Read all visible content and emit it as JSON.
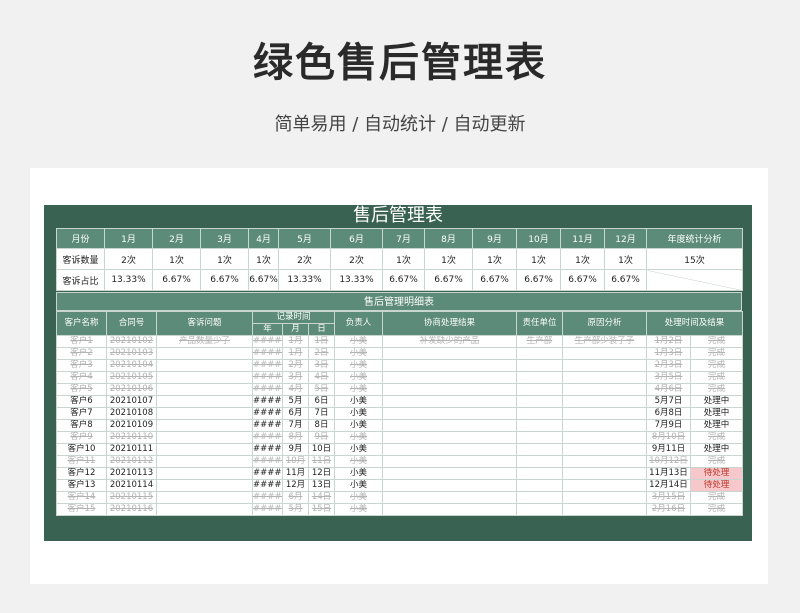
{
  "page": {
    "title": "绿色售后管理表",
    "subtitle": "简单易用 / 自动统计 / 自动更新"
  },
  "sheet": {
    "title": "售后管理表",
    "stats": {
      "header": [
        "月份",
        "1月",
        "2月",
        "3月",
        "4月",
        "5月",
        "6月",
        "7月",
        "8月",
        "9月",
        "10月",
        "11月",
        "12月",
        "年度统计分析"
      ],
      "count_label": "客诉数量",
      "counts": [
        "2次",
        "1次",
        "1次",
        "1次",
        "2次",
        "2次",
        "1次",
        "1次",
        "1次",
        "1次",
        "1次",
        "1次",
        "15次"
      ],
      "ratio_label": "客诉占比",
      "ratios": [
        "13.33%",
        "6.67%",
        "6.67%",
        "6.67%",
        "13.33%",
        "13.33%",
        "6.67%",
        "6.67%",
        "6.67%",
        "6.67%",
        "6.67%",
        "6.67%"
      ]
    },
    "detail_title": "售后管理明细表",
    "columns": {
      "customer": "客户名称",
      "contract": "合同号",
      "issue": "客诉问题",
      "record_time": "记录时间",
      "year": "年",
      "month": "月",
      "day": "日",
      "owner": "负责人",
      "negotiation": "协商处理结果",
      "responsible_unit": "责任单位",
      "cause": "原因分析",
      "result_time": "处理时间及结果"
    },
    "rows": [
      {
        "customer": "客户1",
        "contract": "20210102",
        "issue": "产品数量少了",
        "year": "#####",
        "month": "1月",
        "day": "1日",
        "owner": "小美",
        "negotiation": "补发缺少的产品",
        "unit": "生产部",
        "cause": "生产部少装了子",
        "date": "1月2日",
        "status": "完成",
        "state": "done"
      },
      {
        "customer": "客户2",
        "contract": "20210103",
        "issue": "",
        "year": "#####",
        "month": "1月",
        "day": "2日",
        "owner": "小美",
        "negotiation": "",
        "unit": "",
        "cause": "",
        "date": "1月3日",
        "status": "完成",
        "state": "done"
      },
      {
        "customer": "客户3",
        "contract": "20210104",
        "issue": "",
        "year": "#####",
        "month": "2月",
        "day": "3日",
        "owner": "小美",
        "negotiation": "",
        "unit": "",
        "cause": "",
        "date": "2月3日",
        "status": "完成",
        "state": "done"
      },
      {
        "customer": "客户4",
        "contract": "20210105",
        "issue": "",
        "year": "#####",
        "month": "3月",
        "day": "4日",
        "owner": "小美",
        "negotiation": "",
        "unit": "",
        "cause": "",
        "date": "3月5日",
        "status": "完成",
        "state": "done"
      },
      {
        "customer": "客户5",
        "contract": "20210106",
        "issue": "",
        "year": "#####",
        "month": "4月",
        "day": "5日",
        "owner": "小美",
        "negotiation": "",
        "unit": "",
        "cause": "",
        "date": "4月6日",
        "status": "完成",
        "state": "done"
      },
      {
        "customer": "客户6",
        "contract": "20210107",
        "issue": "",
        "year": "#####",
        "month": "5月",
        "day": "6日",
        "owner": "小美",
        "negotiation": "",
        "unit": "",
        "cause": "",
        "date": "5月7日",
        "status": "处理中",
        "state": "open"
      },
      {
        "customer": "客户7",
        "contract": "20210108",
        "issue": "",
        "year": "#####",
        "month": "6月",
        "day": "7日",
        "owner": "小美",
        "negotiation": "",
        "unit": "",
        "cause": "",
        "date": "6月8日",
        "status": "处理中",
        "state": "open"
      },
      {
        "customer": "客户8",
        "contract": "20210109",
        "issue": "",
        "year": "#####",
        "month": "7月",
        "day": "8日",
        "owner": "小美",
        "negotiation": "",
        "unit": "",
        "cause": "",
        "date": "7月9日",
        "status": "处理中",
        "state": "open"
      },
      {
        "customer": "客户9",
        "contract": "20210110",
        "issue": "",
        "year": "#####",
        "month": "8月",
        "day": "9日",
        "owner": "小美",
        "negotiation": "",
        "unit": "",
        "cause": "",
        "date": "8月10日",
        "status": "完成",
        "state": "done"
      },
      {
        "customer": "客户10",
        "contract": "20210111",
        "issue": "",
        "year": "#####",
        "month": "9月",
        "day": "10日",
        "owner": "小美",
        "negotiation": "",
        "unit": "",
        "cause": "",
        "date": "9月11日",
        "status": "处理中",
        "state": "open"
      },
      {
        "customer": "客户11",
        "contract": "20210112",
        "issue": "",
        "year": "#####",
        "month": "10月",
        "day": "11日",
        "owner": "小美",
        "negotiation": "",
        "unit": "",
        "cause": "",
        "date": "10月12日",
        "status": "完成",
        "state": "done"
      },
      {
        "customer": "客户12",
        "contract": "20210113",
        "issue": "",
        "year": "#####",
        "month": "11月",
        "day": "12日",
        "owner": "小美",
        "negotiation": "",
        "unit": "",
        "cause": "",
        "date": "11月13日",
        "status": "待处理",
        "state": "pending"
      },
      {
        "customer": "客户13",
        "contract": "20210114",
        "issue": "",
        "year": "#####",
        "month": "12月",
        "day": "13日",
        "owner": "小美",
        "negotiation": "",
        "unit": "",
        "cause": "",
        "date": "12月14日",
        "status": "待处理",
        "state": "pending"
      },
      {
        "customer": "客户14",
        "contract": "20210115",
        "issue": "",
        "year": "#####",
        "month": "6月",
        "day": "14日",
        "owner": "小美",
        "negotiation": "",
        "unit": "",
        "cause": "",
        "date": "3月15日",
        "status": "完成",
        "state": "done"
      },
      {
        "customer": "客户15",
        "contract": "20210116",
        "issue": "",
        "year": "#####",
        "month": "5月",
        "day": "15日",
        "owner": "小美",
        "negotiation": "",
        "unit": "",
        "cause": "",
        "date": "2月16日",
        "status": "完成",
        "state": "done"
      }
    ]
  },
  "colors": {
    "frame": "#3a6253",
    "header": "#5c8b79",
    "pending_highlight": "#f6c7cb"
  }
}
